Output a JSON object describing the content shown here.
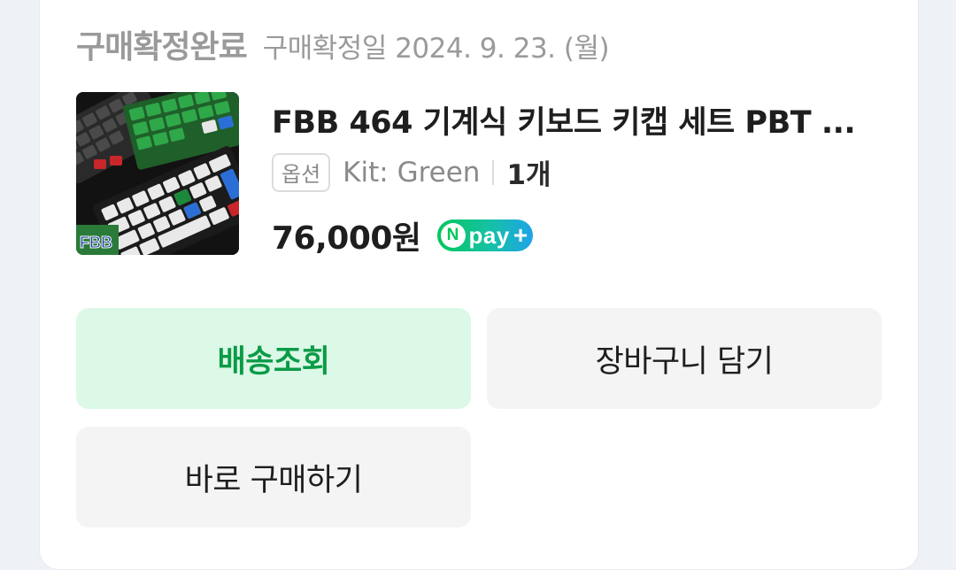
{
  "order": {
    "status": "구매확정완료",
    "confirm_date": "구매확정일 2024. 9. 23. (월)"
  },
  "product": {
    "thumbnail_icon": "keyboard-keycap-product-image",
    "thumbnail_logo": "FBB",
    "name": "FBB 464 기계식 키보드 키캡 세트 PBT ...",
    "option_badge": "옵션",
    "option_value": "Kit: Green",
    "quantity": "1개",
    "price": "76,000원",
    "npay": {
      "n": "N",
      "label": "pay",
      "plus": "+"
    }
  },
  "actions": {
    "track_delivery": "배송조회",
    "add_to_cart": "장바구니 담기",
    "buy_now": "바로 구매하기"
  },
  "colors": {
    "accent_green": "#0b9b47",
    "track_bg": "#dcf8e6",
    "npay_green": "#03c75a",
    "npay_blue": "#1ea3e8"
  }
}
